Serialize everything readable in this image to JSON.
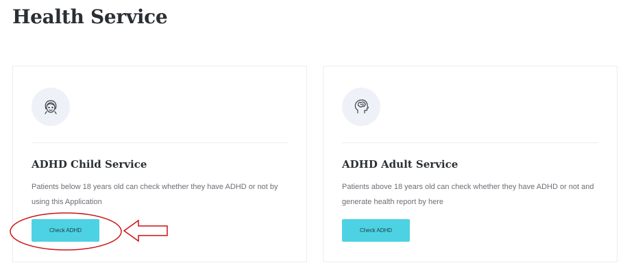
{
  "page": {
    "title": "Health Service"
  },
  "cards": [
    {
      "title": "ADHD Child Service",
      "description": "Patients below 18 years old can check whether they have ADHD or not by using this Application",
      "button_label": "Check ADHD",
      "icon": "child-face-icon"
    },
    {
      "title": "ADHD Adult Service",
      "description": "Patients above 18 years old can check whether they have ADHD or not and generate health report by here",
      "button_label": "Check ADHD",
      "icon": "brain-head-icon"
    }
  ],
  "colors": {
    "button": "#4dd2e3",
    "icon_background": "#eef1f7",
    "annotation": "#cc1111"
  }
}
